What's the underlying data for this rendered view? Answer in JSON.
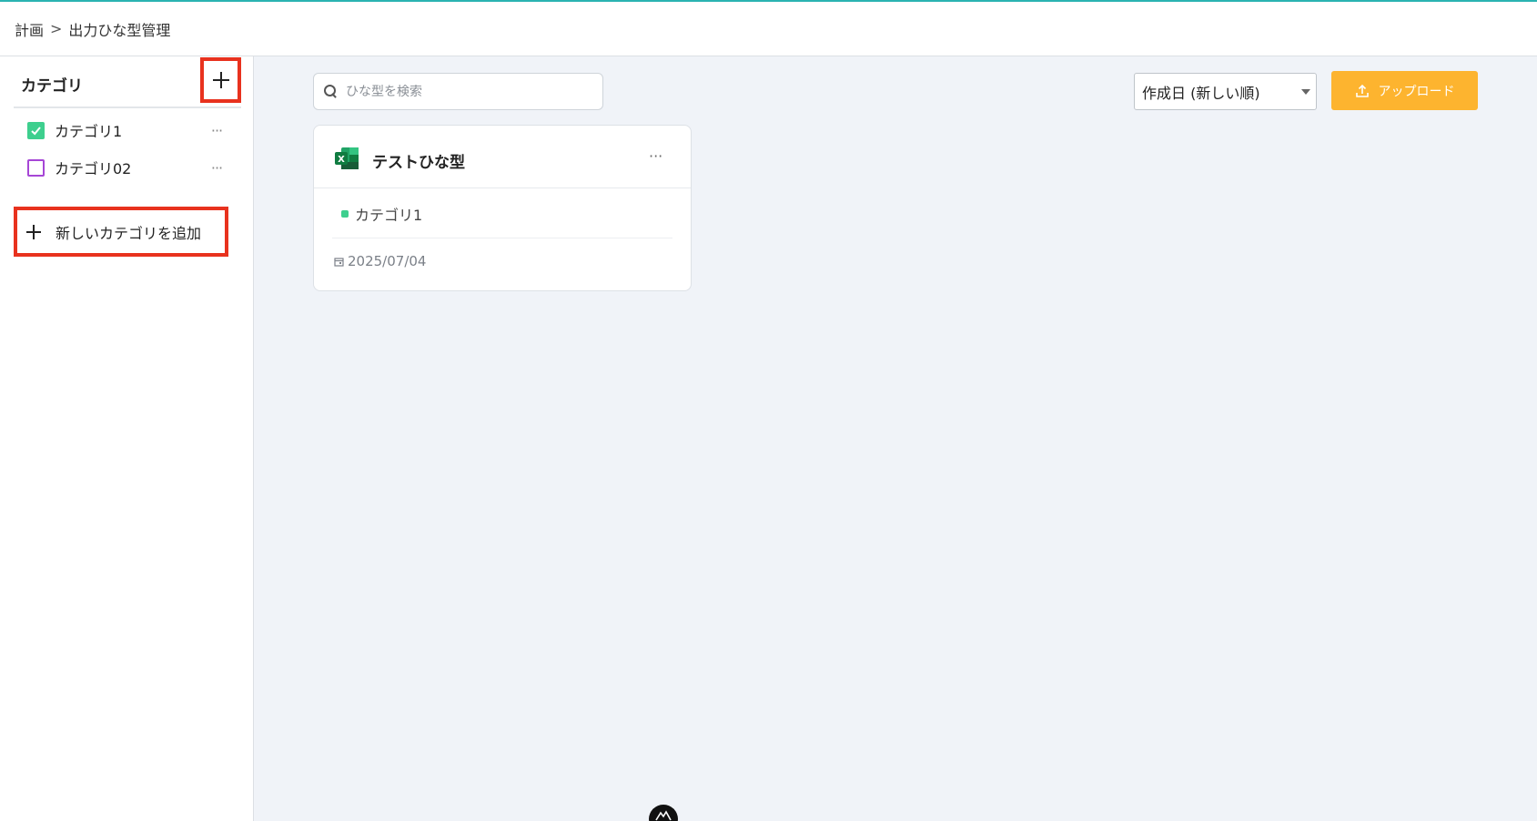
{
  "breadcrumb": {
    "parent": "計画",
    "separator": ">",
    "current": "出力ひな型管理"
  },
  "sidebar": {
    "title": "カテゴリ",
    "add_icon": "plus-icon",
    "categories": [
      {
        "label": "カテゴリ1",
        "checked": true,
        "color": "#3ecf8e",
        "more_icon": "ellipsis-icon"
      },
      {
        "label": "カテゴリ02",
        "checked": false,
        "color": "#a646d6",
        "more_icon": "ellipsis-icon"
      }
    ],
    "add_category_label": "新しいカテゴリを追加"
  },
  "toolbar": {
    "search_placeholder": "ひな型を検索",
    "search_value": "",
    "sort_selected": "作成日 (新しい順)",
    "upload_label": "アップロード",
    "upload_color": "#fdb42f"
  },
  "templates": [
    {
      "title": "テストひな型",
      "file_icon": "excel-icon",
      "category": "カテゴリ1",
      "category_color": "#3ecf8e",
      "date": "2025/07/04"
    }
  ],
  "colors": {
    "accent_line": "#2bb3b1",
    "highlight_border": "#e8321e",
    "main_background": "#f0f3f8"
  }
}
